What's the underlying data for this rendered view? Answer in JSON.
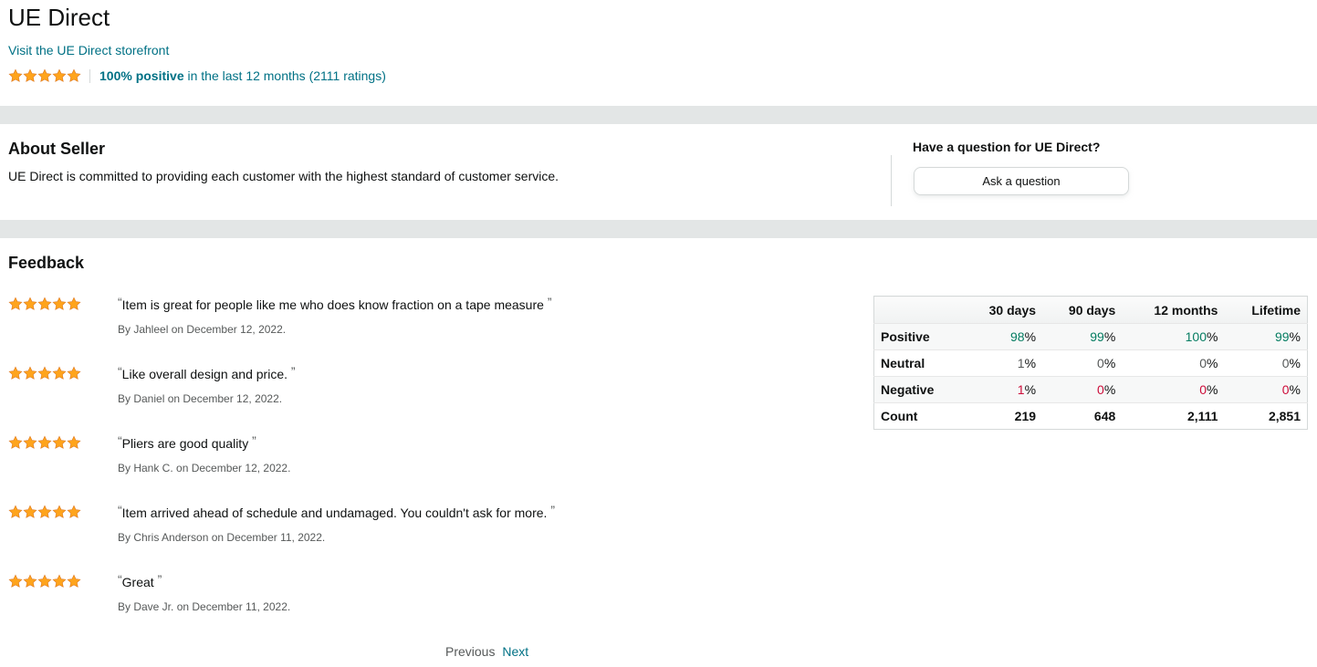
{
  "seller": {
    "name": "UE Direct",
    "storefront_link": "Visit the UE Direct storefront",
    "rating_positive": "100% positive",
    "rating_suffix": " in the last 12 months (2111 ratings)",
    "star_rating": 5
  },
  "about": {
    "heading": "About Seller",
    "text": "UE Direct is committed to providing each customer with the highest standard of customer service."
  },
  "question": {
    "heading": "Have a question for UE Direct?",
    "button_label": "Ask a question"
  },
  "feedback": {
    "heading": "Feedback",
    "reviews": [
      {
        "stars": 5,
        "text": "Item is great for people like me who does know fraction on a tape measure",
        "byline": "By Jahleel on December 12, 2022."
      },
      {
        "stars": 5,
        "text": "Like overall design and price.",
        "byline": "By Daniel on December 12, 2022."
      },
      {
        "stars": 5,
        "text": "Pliers are good quality",
        "byline": "By Hank C. on December 12, 2022."
      },
      {
        "stars": 5,
        "text": "Item arrived ahead of schedule and undamaged. You couldn't ask for more.",
        "byline": "By Chris Anderson on December 11, 2022."
      },
      {
        "stars": 5,
        "text": "Great",
        "byline": "By Dave Jr. on December 11, 2022."
      }
    ]
  },
  "stats": {
    "columns": [
      "",
      "30 days",
      "90 days",
      "12 months",
      "Lifetime"
    ],
    "rows": [
      {
        "label": "Positive",
        "values": [
          "98",
          "99",
          "100",
          "99"
        ],
        "kind": "pos"
      },
      {
        "label": "Neutral",
        "values": [
          "1",
          "0",
          "0",
          "0"
        ],
        "kind": "neu"
      },
      {
        "label": "Negative",
        "values": [
          "1",
          "0",
          "0",
          "0"
        ],
        "kind": "neg"
      },
      {
        "label": "Count",
        "values": [
          "219",
          "648",
          "2,111",
          "2,851"
        ],
        "kind": "count"
      }
    ],
    "percent_sign": "%"
  },
  "pager": {
    "previous": "Previous",
    "next": "Next"
  },
  "colors": {
    "star": "#ffa41c",
    "link": "#007185",
    "positive": "#067d62",
    "negative": "#cc0c39",
    "band": "#e3e6e6"
  },
  "quote_marks": {
    "open": "“",
    "close": "”"
  }
}
